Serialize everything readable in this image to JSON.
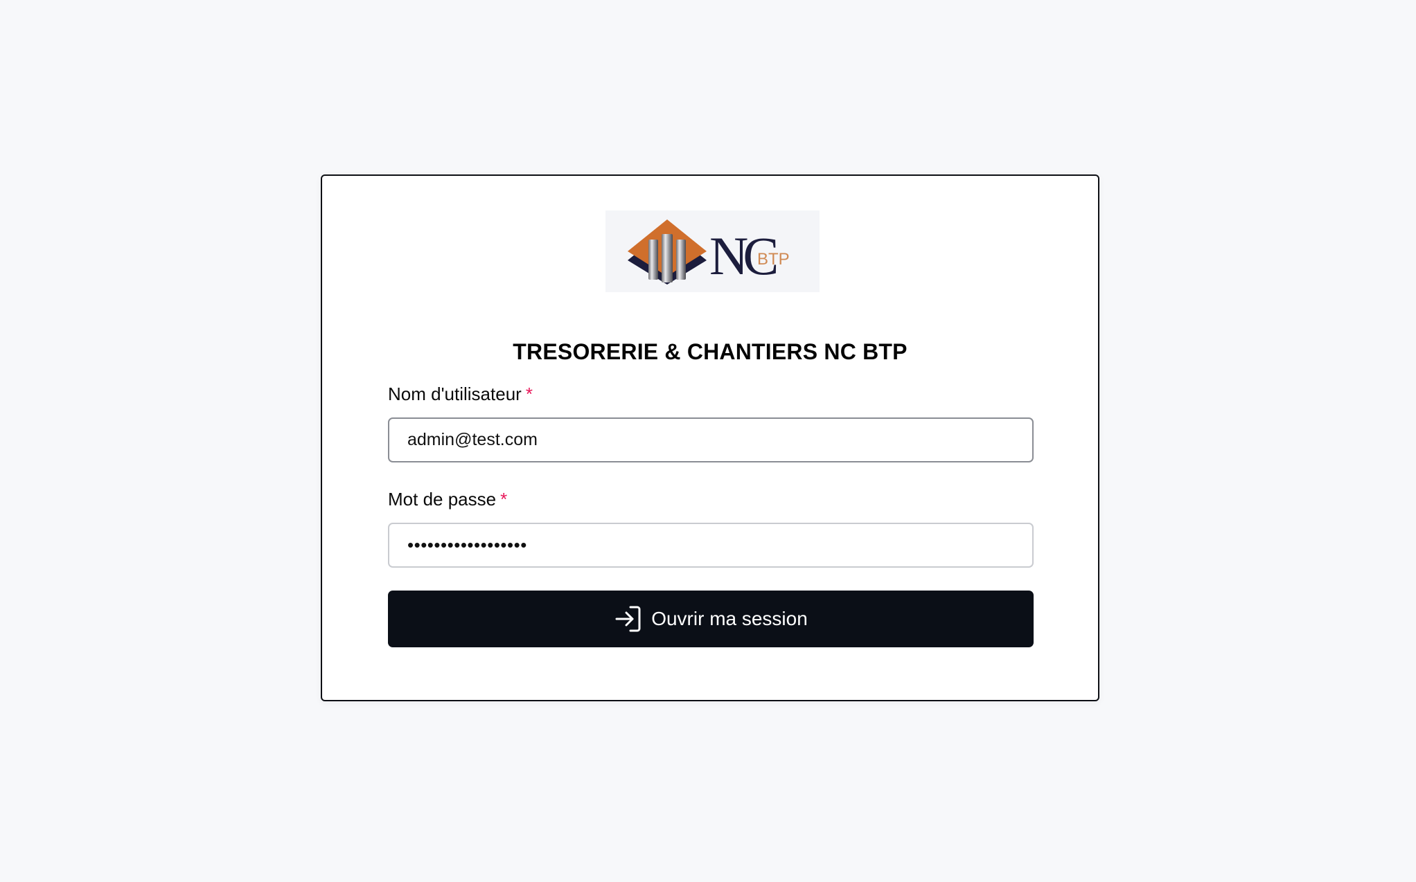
{
  "app": {
    "title": "TRESORERIE & CHANTIERS NC BTP"
  },
  "logo": {
    "text_main": "NC",
    "text_sub": "BTP",
    "colors": {
      "diamond": "#d06f2c",
      "navy": "#1c1d3d",
      "sub_text": "#d08a54"
    }
  },
  "form": {
    "username": {
      "label": "Nom d'utilisateur",
      "required_mark": "*",
      "value": "admin@test.com"
    },
    "password": {
      "label": "Mot de passe",
      "required_mark": "*",
      "value": "••••••••••••••••••"
    },
    "submit": {
      "label": "Ouvrir ma session",
      "icon": "login-arrow-icon"
    }
  },
  "colors": {
    "background": "#f7f8fa",
    "card": "#ffffff",
    "button": "#0b0f17",
    "required": "#e8185a"
  }
}
